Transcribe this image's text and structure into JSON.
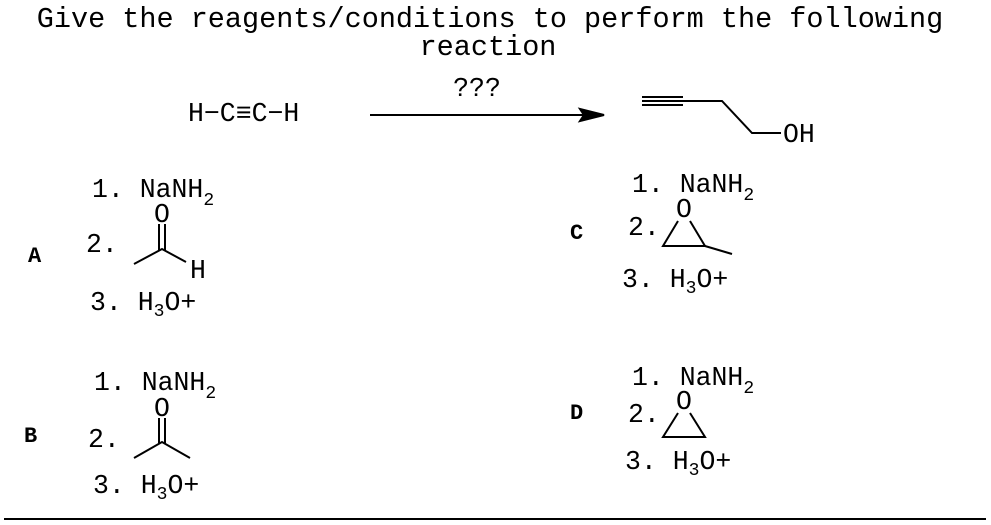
{
  "question": {
    "line1": "Give the reagents/conditions to perform the following",
    "line2": "reaction"
  },
  "reaction": {
    "arrow_label": "???",
    "reactant": "H−C≡C−H",
    "product_group": "OH"
  },
  "options": {
    "A": {
      "label": "A",
      "s1": "1. NaNH",
      "s1_sub": "2",
      "s2": "2.",
      "o": "O",
      "h": "H",
      "s3": "3. H",
      "s3_sub": "3",
      "s3_end": "O+"
    },
    "B": {
      "label": "B",
      "s1": "1. NaNH",
      "s1_sub": "2",
      "s2": "2.",
      "o": "O",
      "s3": "3. H",
      "s3_sub": "3",
      "s3_end": "O+"
    },
    "C": {
      "label": "C",
      "s1": "1. NaNH",
      "s1_sub": "2",
      "s2": "2.",
      "o": "O",
      "s3": "3. H",
      "s3_sub": "3",
      "s3_end": "O+"
    },
    "D": {
      "label": "D",
      "s1": "1. NaNH",
      "s1_sub": "2",
      "s2": "2.",
      "o": "O",
      "s3": "3. H",
      "s3_sub": "3",
      "s3_end": "O+"
    }
  }
}
